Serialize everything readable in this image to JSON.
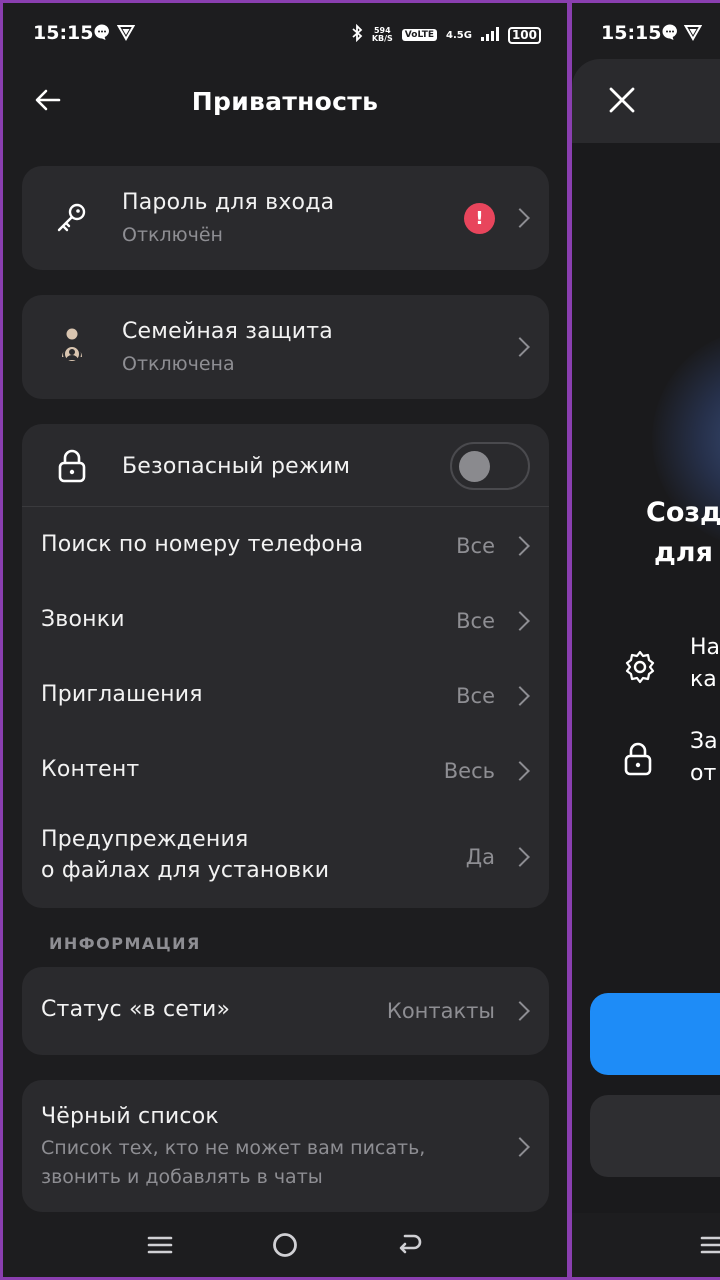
{
  "status_bar": {
    "time": "15:15",
    "speed_value": "594",
    "speed_unit": "KB/S",
    "volte": "VoLTE",
    "network": "4.5G",
    "battery": "100"
  },
  "header": {
    "title": "Приватность"
  },
  "login_password": {
    "title": "Пароль для входа",
    "subtitle": "Отключён",
    "badge": "!"
  },
  "family_protection": {
    "title": "Семейная защита",
    "subtitle": "Отключена"
  },
  "safe_mode": {
    "title": "Безопасный режим",
    "enabled": false
  },
  "settings_rows": [
    {
      "label": "Поиск по номеру телефона",
      "value": "Все"
    },
    {
      "label": "Звонки",
      "value": "Все"
    },
    {
      "label": "Приглашения",
      "value": "Все"
    },
    {
      "label": "Контент",
      "value": "Весь"
    },
    {
      "label": "Предупреждения",
      "label2": "о файлах для установки",
      "value": "Да"
    }
  ],
  "info_section": {
    "label": "ИНФОРМАЦИЯ",
    "online_status": {
      "label": "Статус «в сети»",
      "value": "Контакты"
    }
  },
  "blacklist": {
    "title": "Чёрный список",
    "subtitle_line1": "Список тех, кто не может вам писать,",
    "subtitle_line2": "звонить и добавлять в чаты"
  },
  "right_panel": {
    "time": "15:15",
    "title_line1": "Созд",
    "title_line2": "для",
    "item1_line1": "На",
    "item1_line2": "ка",
    "item2_line1": "За",
    "item2_line2": "от"
  },
  "colors": {
    "background": "#1d1d1f",
    "card": "#2a2a2d",
    "alert": "#e8455c",
    "accent": "#1e8cf7",
    "border": "#8a3fb0"
  }
}
